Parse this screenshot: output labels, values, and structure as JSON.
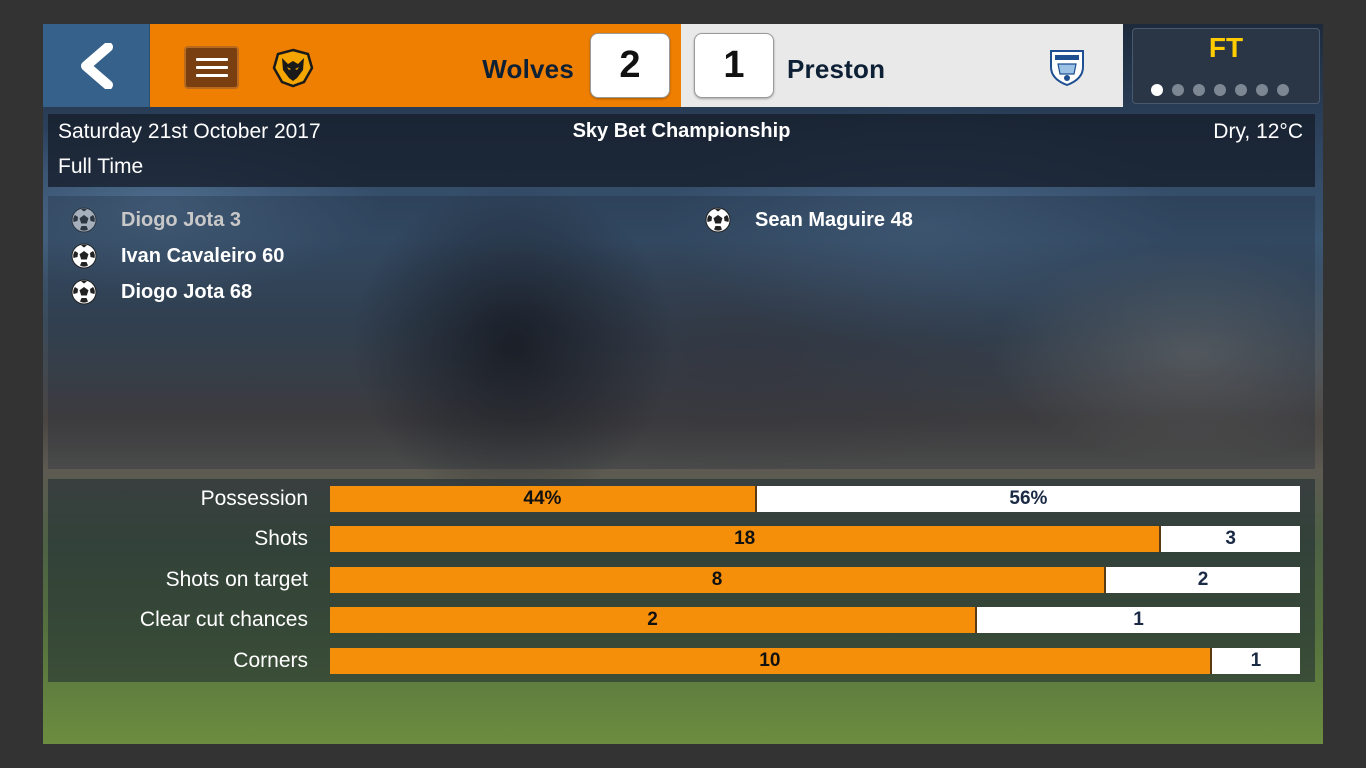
{
  "header": {
    "home": {
      "name": "Wolves",
      "score": "2"
    },
    "away": {
      "name": "Preston",
      "score": "1"
    },
    "status": "FT",
    "page_dots": {
      "count": 7,
      "active": 1
    },
    "colors": {
      "home_panel": "#ee7f00",
      "away_panel": "#e9e9e9",
      "back_button": "#35618a",
      "status_text": "#ffcc00"
    },
    "icons": {
      "back": "chevron-left-icon",
      "menu": "hamburger-menu-icon",
      "home_crest": "wolves-crest-icon",
      "away_crest": "preston-crest-icon"
    }
  },
  "info": {
    "date": "Saturday 21st October 2017",
    "match_status": "Full Time",
    "competition": "Sky Bet Championship",
    "weather": "Dry, 12°C"
  },
  "goals": {
    "home": [
      {
        "text": "Diogo Jota 3",
        "dim": true
      },
      {
        "text": "Ivan Cavaleiro 60",
        "dim": false
      },
      {
        "text": "Diogo Jota 68",
        "dim": false
      }
    ],
    "away": [
      {
        "text": "Sean Maguire 48",
        "dim": false
      }
    ]
  },
  "stats": [
    {
      "label": "Possession",
      "home": "44%",
      "away": "56%",
      "home_share": 0.44
    },
    {
      "label": "Shots",
      "home": "18",
      "away": "3",
      "home_share": 0.857
    },
    {
      "label": "Shots on target",
      "home": "8",
      "away": "2",
      "home_share": 0.8
    },
    {
      "label": "Clear cut chances",
      "home": "2",
      "away": "1",
      "home_share": 0.667
    },
    {
      "label": "Corners",
      "home": "10",
      "away": "1",
      "home_share": 0.909
    }
  ]
}
